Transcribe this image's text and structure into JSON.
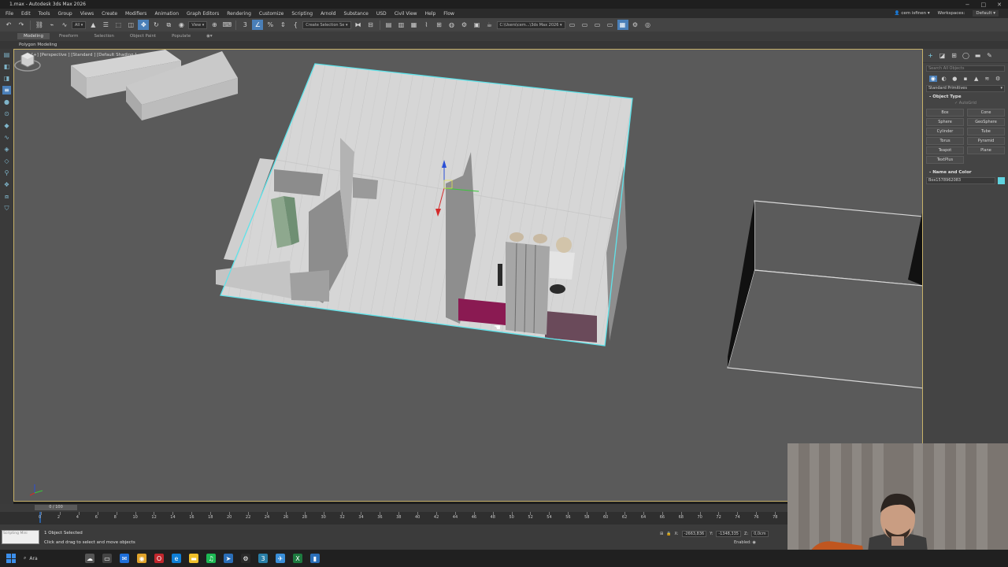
{
  "window": {
    "title": "1.max - Autodesk 3ds Max 2026",
    "controls": [
      "−",
      "□",
      "✕"
    ]
  },
  "menu": {
    "items": [
      "File",
      "Edit",
      "Tools",
      "Group",
      "Views",
      "Create",
      "Modifiers",
      "Animation",
      "Graph Editors",
      "Rendering",
      "Customize",
      "Scripting",
      "Arnold",
      "Substance",
      "USD",
      "Civil View",
      "Help",
      "Flow"
    ],
    "user": "cem isfinen",
    "workspaces_label": "Workspaces:",
    "workspace_value": "Default"
  },
  "toolbar": {
    "filter_value": "All",
    "view_value": "View",
    "selection_set": "Create Selection Se",
    "path": "C:\\Users\\cem...\\3ds Max 2026"
  },
  "ribbon": {
    "tabs": [
      "Modeling",
      "Freeform",
      "Selection",
      "Object Paint",
      "Populate"
    ],
    "sub_label": "Polygon Modeling"
  },
  "viewport": {
    "label": "[+] [Perspective ] [Standard ] [Default Shading ]",
    "accent_color": "#5fe3ea"
  },
  "command_panel": {
    "search_placeholder": "Search All Objects",
    "category": "Standard Primitives",
    "object_type_title": "Object Type",
    "autogrid_label": "AutoGrid",
    "primitives": [
      "Box",
      "Cone",
      "Sphere",
      "GeoSphere",
      "Cylinder",
      "Tube",
      "Torus",
      "Pyramid",
      "Teapot",
      "Plane",
      "TextPlus"
    ],
    "name_color_title": "Name and Color",
    "object_name": "Box1578962083",
    "object_color": "#5fd3df"
  },
  "timeline": {
    "slider_text": "0 / 100",
    "ticks": [
      "0",
      "2",
      "4",
      "6",
      "8",
      "10",
      "12",
      "14",
      "16",
      "18",
      "20",
      "22",
      "24",
      "26",
      "28",
      "30",
      "32",
      "34",
      "36",
      "38",
      "40",
      "42",
      "44",
      "46",
      "48",
      "50",
      "52",
      "54",
      "56",
      "58",
      "60",
      "62",
      "64",
      "66",
      "68",
      "70",
      "72",
      "74",
      "76",
      "78"
    ]
  },
  "status": {
    "maxscript_label": "Scripting Mini",
    "selection": "1 Object Selected",
    "hint": "Click and drag to select and move objects",
    "x": "-2663,836",
    "y": "-1348,335",
    "z": "0,0cm",
    "enabled_label": "Enabled:"
  },
  "taskbar": {
    "search_label": "Ara"
  }
}
